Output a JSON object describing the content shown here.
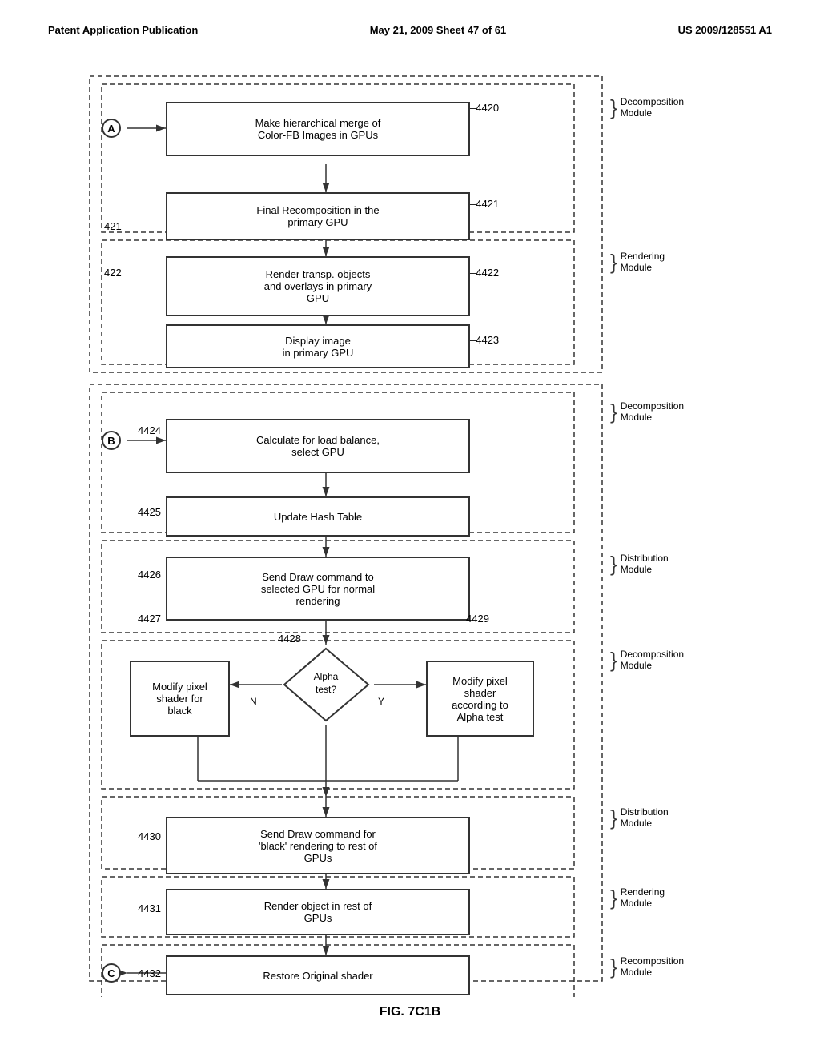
{
  "header": {
    "left": "Patent Application Publication",
    "center": "May 21, 2009   Sheet 47 of 61",
    "right": "US 2009/128551 A1"
  },
  "figure_caption": "FIG. 7C1B",
  "nodes": {
    "n4420": {
      "label": "Make hierarchical merge of\nColor-FB Images in GPUs",
      "id": "4420"
    },
    "n4421": {
      "label": "Final Recomposition in the\nprimary GPU",
      "id": "4421"
    },
    "n4422": {
      "label": "Render transp. objects\nand overlays in primary\nGPU",
      "id": "4422"
    },
    "n4423": {
      "label": "Display image\nin primary GPU",
      "id": "4423"
    },
    "n4424": {
      "label": "Calculate for load balance,\nselect GPU",
      "id": "4424"
    },
    "n4425": {
      "label": "Update Hash Table",
      "id": "4425"
    },
    "n4426": {
      "label": "Send Draw command to\nselected GPU for normal\nrendering",
      "id": "4426"
    },
    "n4428": {
      "label": "Alpha\ntest?",
      "id": "4428"
    },
    "n4427_label": {
      "label": "4427"
    },
    "n4429_label": {
      "label": "4429"
    },
    "n4427_mod": {
      "label": "Modify pixel\nshader for\nblack",
      "id": "4427"
    },
    "n4429_mod": {
      "label": "Modify pixel\nshader\naccording to\nAlpha test",
      "id": "4429"
    },
    "n4430": {
      "label": "Send Draw command for\n'black' rendering to rest of\nGPUs",
      "id": "4430"
    },
    "n4431": {
      "label": "Render object in rest of\nGPUs",
      "id": "4431"
    },
    "n4432": {
      "label": "Restore Original shader",
      "id": "4432"
    }
  },
  "modules": {
    "decomp1": "Decomposition\nModule",
    "rendering1": "Rendering\nModule",
    "decomp2": "Decomposition\nModule",
    "dist1": "Distribution\nModule",
    "decomp3": "Decomposition\nModule",
    "dist2": "Distribution\nModule",
    "rendering2": "Rendering\nModule",
    "recomp": "Recomposition\nModule"
  },
  "labels": {
    "A": "A",
    "B": "B",
    "C": "C",
    "N": "N",
    "Y": "Y"
  }
}
